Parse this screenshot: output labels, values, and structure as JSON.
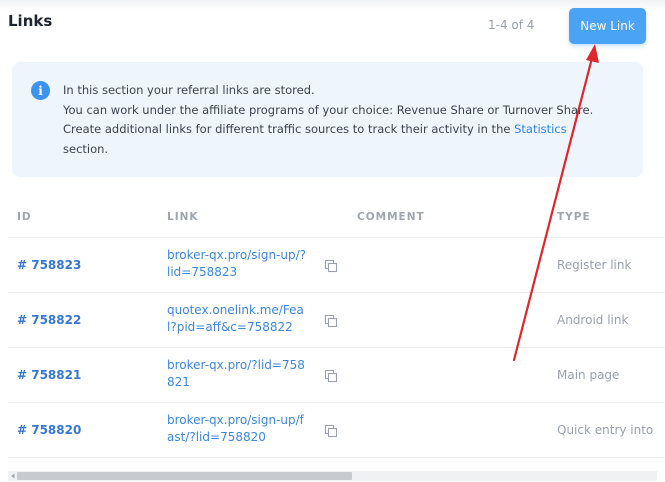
{
  "header": {
    "title": "Links",
    "pager": "1-4 of 4",
    "new_link_label": "New Link"
  },
  "info": {
    "icon": "info-icon",
    "line1": "In this section your referral links are stored.",
    "line2": "You can work under the affiliate programs of your choice: Revenue Share or Turnover Share.",
    "line3_prefix": "Create additional links for different traffic sources to track their activity in the ",
    "line3_link": "Statistics",
    "line4": "section."
  },
  "table": {
    "columns": [
      "ID",
      "LINK",
      "COMMENT",
      "TYPE"
    ],
    "rows": [
      {
        "id": "# 758823",
        "link": "broker-qx.pro/sign-up/?lid=758823",
        "comment": "",
        "type": "Register link"
      },
      {
        "id": "# 758822",
        "link": "quotex.onelink.me/Feal?pid=aff&c=758822",
        "comment": "",
        "type": "Android link"
      },
      {
        "id": "# 758821",
        "link": "broker-qx.pro/?lid=758821",
        "comment": "",
        "type": "Main page"
      },
      {
        "id": "# 758820",
        "link": "broker-qx.pro/sign-up/fast/?lid=758820",
        "comment": "",
        "type": "Quick entry into"
      }
    ]
  },
  "colors": {
    "accent": "#4aa3f5",
    "link": "#3b87e4",
    "annotation": "#e0262b"
  }
}
